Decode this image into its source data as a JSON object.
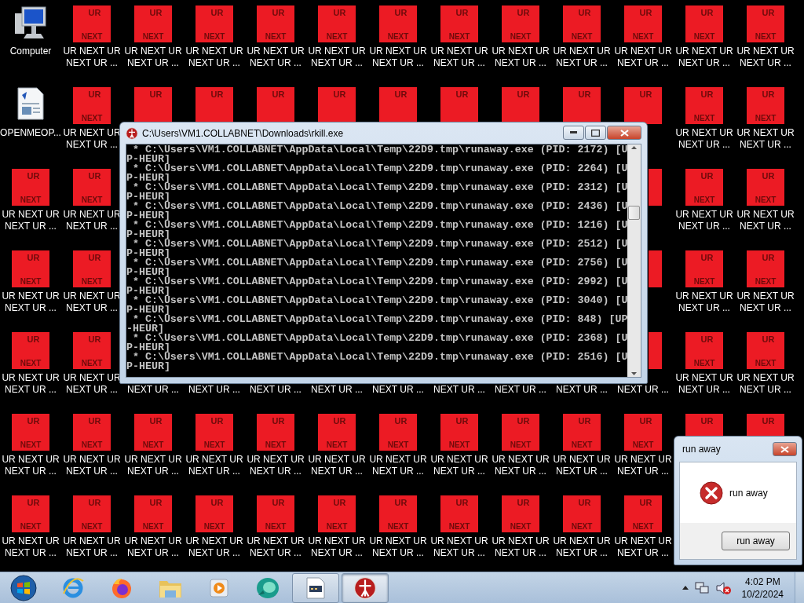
{
  "desktop": {
    "rows": [
      [
        {
          "kind": "computer",
          "line1": "Computer"
        },
        {
          "kind": "ur",
          "top": "UR",
          "bottom": "NEXT",
          "line1": "UR NEXT UR",
          "line2": "NEXT UR ..."
        },
        {
          "kind": "ur",
          "top": "UR",
          "bottom": "NEXT",
          "line1": "UR NEXT UR",
          "line2": "NEXT UR ..."
        },
        {
          "kind": "ur",
          "top": "UR",
          "bottom": "NEXT",
          "line1": "UR NEXT UR",
          "line2": "NEXT UR ..."
        },
        {
          "kind": "ur",
          "top": "UR",
          "bottom": "NEXT",
          "line1": "UR NEXT UR",
          "line2": "NEXT UR ..."
        },
        {
          "kind": "ur",
          "top": "UR",
          "bottom": "NEXT",
          "line1": "UR NEXT UR",
          "line2": "NEXT UR ..."
        },
        {
          "kind": "ur",
          "top": "UR",
          "bottom": "NEXT",
          "line1": "UR NEXT UR",
          "line2": "NEXT UR ..."
        },
        {
          "kind": "ur",
          "top": "UR",
          "bottom": "NEXT",
          "line1": "UR NEXT UR",
          "line2": "NEXT UR ..."
        },
        {
          "kind": "ur",
          "top": "UR",
          "bottom": "NEXT",
          "line1": "UR NEXT UR",
          "line2": "NEXT UR ..."
        },
        {
          "kind": "ur",
          "top": "UR",
          "bottom": "NEXT",
          "line1": "UR NEXT UR",
          "line2": "NEXT UR ..."
        },
        {
          "kind": "ur",
          "top": "UR",
          "bottom": "NEXT",
          "line1": "UR NEXT UR",
          "line2": "NEXT UR ..."
        },
        {
          "kind": "ur",
          "top": "UR",
          "bottom": "NEXT",
          "line1": "UR NEXT UR",
          "line2": "NEXT UR ..."
        },
        {
          "kind": "ur",
          "top": "UR",
          "bottom": "NEXT",
          "line1": "UR NEXT UR",
          "line2": "NEXT UR ..."
        }
      ],
      [
        {
          "kind": "document",
          "line1": "OPENMEOP..."
        },
        {
          "kind": "ur",
          "top": "UR",
          "bottom": "NEXT",
          "line1": "UR NEXT UR",
          "line2": "NEXT UR ..."
        },
        {
          "kind": "ur",
          "top": "UR"
        },
        {
          "kind": "ur",
          "top": "UR"
        },
        {
          "kind": "ur",
          "top": "UR"
        },
        {
          "kind": "ur",
          "top": "UR"
        },
        {
          "kind": "ur",
          "top": "UR"
        },
        {
          "kind": "ur",
          "top": "UR"
        },
        {
          "kind": "ur",
          "top": "UR"
        },
        {
          "kind": "ur",
          "top": "UR"
        },
        {
          "kind": "ur",
          "top": "UR"
        },
        {
          "kind": "ur",
          "top": "UR",
          "bottom": "NEXT",
          "line1": "UR NEXT UR",
          "line2": "NEXT UR ..."
        },
        {
          "kind": "ur",
          "top": "UR",
          "bottom": "NEXT",
          "line1": "UR NEXT UR",
          "line2": "NEXT UR ..."
        }
      ],
      [
        {
          "kind": "ur",
          "top": "UR",
          "bottom": "NEXT",
          "line1": "UR NEXT UR",
          "line2": "NEXT UR ..."
        },
        {
          "kind": "ur",
          "top": "UR",
          "bottom": "NEXT",
          "line1": "UR NEXT UR",
          "line2": "NEXT UR ..."
        },
        null,
        null,
        null,
        null,
        null,
        null,
        null,
        null,
        {
          "kind": "ur_edge"
        },
        {
          "kind": "ur",
          "top": "UR",
          "bottom": "NEXT",
          "line1": "UR NEXT UR",
          "line2": "NEXT UR ..."
        },
        {
          "kind": "ur",
          "top": "UR",
          "bottom": "NEXT",
          "line1": "UR NEXT UR",
          "line2": "NEXT UR ..."
        }
      ],
      [
        {
          "kind": "ur",
          "top": "UR",
          "bottom": "NEXT",
          "line1": "UR NEXT UR",
          "line2": "NEXT UR ..."
        },
        {
          "kind": "ur",
          "top": "UR",
          "bottom": "NEXT",
          "line1": "UR NEXT UR",
          "line2": "NEXT UR ..."
        },
        null,
        null,
        null,
        null,
        null,
        null,
        null,
        null,
        {
          "kind": "ur_edge"
        },
        {
          "kind": "ur",
          "top": "UR",
          "bottom": "NEXT",
          "line1": "UR NEXT UR",
          "line2": "NEXT UR ..."
        },
        {
          "kind": "ur",
          "top": "UR",
          "bottom": "NEXT",
          "line1": "UR NEXT UR",
          "line2": "NEXT UR ..."
        }
      ],
      [
        {
          "kind": "ur",
          "top": "UR",
          "bottom": "NEXT",
          "line1": "UR NEXT UR",
          "line2": "NEXT UR ..."
        },
        {
          "kind": "ur",
          "top": "UR",
          "bottom": "NEXT",
          "line1": "UR NEXT UR",
          "line2": "NEXT UR ..."
        },
        {
          "kind": "label",
          "line2": "NEXT UR ..."
        },
        {
          "kind": "label",
          "line2": "NEXT UR ..."
        },
        {
          "kind": "label",
          "line2": "NEXT UR ..."
        },
        {
          "kind": "label",
          "line2": "NEXT UR ..."
        },
        {
          "kind": "label",
          "line2": "NEXT UR ..."
        },
        {
          "kind": "label",
          "line2": "NEXT UR ..."
        },
        {
          "kind": "label",
          "line2": "NEXT UR ..."
        },
        {
          "kind": "label",
          "line2": "NEXT UR ..."
        },
        {
          "kind": "ur_edge",
          "line2": "NEXT UR ..."
        },
        {
          "kind": "ur",
          "top": "UR",
          "bottom": "NEXT",
          "line1": "UR NEXT UR",
          "line2": "NEXT UR ..."
        },
        {
          "kind": "ur",
          "top": "UR",
          "bottom": "NEXT",
          "line1": "UR NEXT UR",
          "line2": "NEXT UR ..."
        }
      ],
      [
        {
          "kind": "ur",
          "top": "UR",
          "bottom": "NEXT",
          "line1": "UR NEXT UR",
          "line2": "NEXT UR ..."
        },
        {
          "kind": "ur",
          "top": "UR",
          "bottom": "NEXT",
          "line1": "UR NEXT UR",
          "line2": "NEXT UR ..."
        },
        {
          "kind": "ur",
          "top": "UR",
          "bottom": "NEXT",
          "line1": "UR NEXT UR",
          "line2": "NEXT UR ..."
        },
        {
          "kind": "ur",
          "top": "UR",
          "bottom": "NEXT",
          "line1": "UR NEXT UR",
          "line2": "NEXT UR ..."
        },
        {
          "kind": "ur",
          "top": "UR",
          "bottom": "NEXT",
          "line1": "UR NEXT UR",
          "line2": "NEXT UR ..."
        },
        {
          "kind": "ur",
          "top": "UR",
          "bottom": "NEXT",
          "line1": "UR NEXT UR",
          "line2": "NEXT UR ..."
        },
        {
          "kind": "ur",
          "top": "UR",
          "bottom": "NEXT",
          "line1": "UR NEXT UR",
          "line2": "NEXT UR ..."
        },
        {
          "kind": "ur",
          "top": "UR",
          "bottom": "NEXT",
          "line1": "UR NEXT UR",
          "line2": "NEXT UR ..."
        },
        {
          "kind": "ur",
          "top": "UR",
          "bottom": "NEXT",
          "line1": "UR NEXT UR",
          "line2": "NEXT UR ..."
        },
        {
          "kind": "ur",
          "top": "UR",
          "bottom": "NEXT",
          "line1": "UR NEXT UR",
          "line2": "NEXT UR ..."
        },
        {
          "kind": "ur",
          "top": "UR",
          "bottom": "NEXT",
          "line1": "UR NEXT UR",
          "line2": "NEXT UR ..."
        },
        {
          "kind": "ur",
          "top": "UR"
        },
        {
          "kind": "ur",
          "top": "UR"
        }
      ],
      [
        {
          "kind": "ur",
          "top": "UR",
          "bottom": "NEXT",
          "line1": "UR NEXT UR",
          "line2": "NEXT UR ..."
        },
        {
          "kind": "ur",
          "top": "UR",
          "bottom": "NEXT",
          "line1": "UR NEXT UR",
          "line2": "NEXT UR ..."
        },
        {
          "kind": "ur",
          "top": "UR",
          "bottom": "NEXT",
          "line1": "UR NEXT UR",
          "line2": "NEXT UR ..."
        },
        {
          "kind": "ur",
          "top": "UR",
          "bottom": "NEXT",
          "line1": "UR NEXT UR",
          "line2": "NEXT UR ..."
        },
        {
          "kind": "ur",
          "top": "UR",
          "bottom": "NEXT",
          "line1": "UR NEXT UR",
          "line2": "NEXT UR ..."
        },
        {
          "kind": "ur",
          "top": "UR",
          "bottom": "NEXT",
          "line1": "UR NEXT UR",
          "line2": "NEXT UR ..."
        },
        {
          "kind": "ur",
          "top": "UR",
          "bottom": "NEXT",
          "line1": "UR NEXT UR",
          "line2": "NEXT UR ..."
        },
        {
          "kind": "ur",
          "top": "UR",
          "bottom": "NEXT",
          "line1": "UR NEXT UR",
          "line2": "NEXT UR ..."
        },
        {
          "kind": "ur",
          "top": "UR",
          "bottom": "NEXT",
          "line1": "UR NEXT UR",
          "line2": "NEXT UR ..."
        },
        {
          "kind": "ur",
          "top": "UR",
          "bottom": "NEXT",
          "line1": "UR NEXT UR",
          "line2": "NEXT UR ..."
        },
        {
          "kind": "ur",
          "top": "UR",
          "bottom": "NEXT",
          "line1": "UR NEXT UR",
          "line2": "NEXT UR ..."
        },
        null,
        null
      ]
    ]
  },
  "console_window": {
    "title": "C:\\Users\\VM1.COLLABNET\\Downloads\\rkill.exe",
    "lines": [
      " * C:\\Users\\VM1.COLLABNET\\AppData\\Local\\Temp\\22D9.tmp\\runaway.exe (PID: 2172) [U",
      "P-HEUR]",
      " * C:\\Users\\VM1.COLLABNET\\AppData\\Local\\Temp\\22D9.tmp\\runaway.exe (PID: 2264) [U",
      "P-HEUR]",
      " * C:\\Users\\VM1.COLLABNET\\AppData\\Local\\Temp\\22D9.tmp\\runaway.exe (PID: 2312) [U",
      "P-HEUR]",
      " * C:\\Users\\VM1.COLLABNET\\AppData\\Local\\Temp\\22D9.tmp\\runaway.exe (PID: 2436) [U",
      "P-HEUR]",
      " * C:\\Users\\VM1.COLLABNET\\AppData\\Local\\Temp\\22D9.tmp\\runaway.exe (PID: 1216) [U",
      "P-HEUR]",
      " * C:\\Users\\VM1.COLLABNET\\AppData\\Local\\Temp\\22D9.tmp\\runaway.exe (PID: 2512) [U",
      "P-HEUR]",
      " * C:\\Users\\VM1.COLLABNET\\AppData\\Local\\Temp\\22D9.tmp\\runaway.exe (PID: 2756) [U",
      "P-HEUR]",
      " * C:\\Users\\VM1.COLLABNET\\AppData\\Local\\Temp\\22D9.tmp\\runaway.exe (PID: 2992) [U",
      "P-HEUR]",
      " * C:\\Users\\VM1.COLLABNET\\AppData\\Local\\Temp\\22D9.tmp\\runaway.exe (PID: 3040) [U",
      "P-HEUR]",
      " * C:\\Users\\VM1.COLLABNET\\AppData\\Local\\Temp\\22D9.tmp\\runaway.exe (PID: 848) [UP",
      "-HEUR]",
      " * C:\\Users\\VM1.COLLABNET\\AppData\\Local\\Temp\\22D9.tmp\\runaway.exe (PID: 2368) [U",
      "P-HEUR]",
      " * C:\\Users\\VM1.COLLABNET\\AppData\\Local\\Temp\\22D9.tmp\\runaway.exe (PID: 2516) [U",
      "P-HEUR]"
    ]
  },
  "dialog": {
    "title": "run away",
    "message": "run away",
    "button": "run away"
  },
  "taskbar": {
    "apps": [
      {
        "kind": "ie",
        "running": false,
        "selected": false
      },
      {
        "kind": "firefox",
        "running": false,
        "selected": false
      },
      {
        "kind": "folder",
        "running": false,
        "selected": false
      },
      {
        "kind": "media",
        "running": false,
        "selected": false
      },
      {
        "kind": "teal",
        "running": false,
        "selected": false
      },
      {
        "kind": "document",
        "running": true,
        "selected": false
      },
      {
        "kind": "rkill",
        "running": true,
        "selected": true
      }
    ],
    "volume_muted": true,
    "clock": {
      "time": "4:02 PM",
      "date": "10/2/2024"
    }
  }
}
